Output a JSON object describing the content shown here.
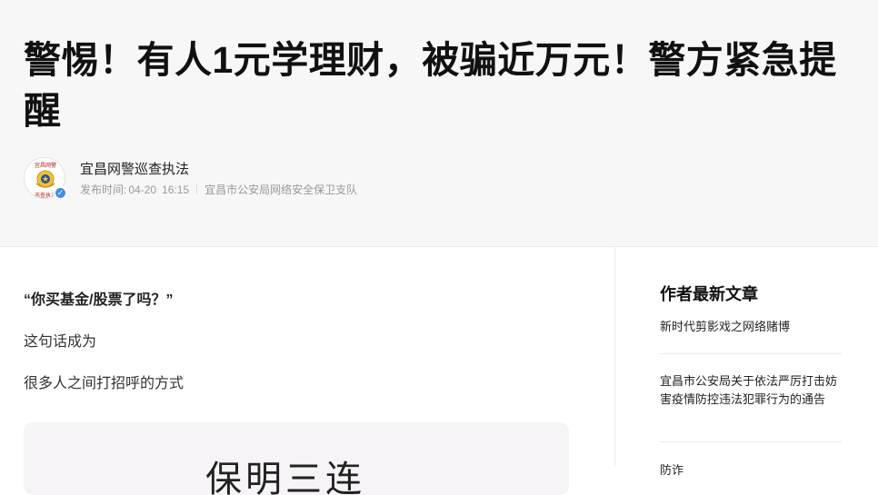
{
  "article": {
    "title": "警惕！有人1元学理财，被骗近万元！警方紧急提醒",
    "author": {
      "name": "宜昌网警巡查执法",
      "avatar_text": [
        "宜昌网警",
        "巡查执法"
      ],
      "verified": true
    },
    "meta": {
      "publish_label": "发布时间:",
      "date": "04-20",
      "time": "16:15",
      "organization": "宜昌市公安局网络安全保卫支队"
    },
    "paragraphs": {
      "quote": "“你买基金/股票了吗？”",
      "p1": "这句话成为",
      "p2": "很多人之间打招呼的方式"
    },
    "image_text": "保明三连"
  },
  "sidebar": {
    "title": "作者最新文章",
    "items": [
      "新时代剪影戏之网络赌博",
      "宜昌市公安局关于依法严厉打击妨害疫情防控违法犯罪行为的通告",
      "防诈"
    ]
  },
  "colors": {
    "header_bg": "#f7f7f7",
    "verify_badge": "#3d8fe7",
    "meta_text": "#999999"
  }
}
